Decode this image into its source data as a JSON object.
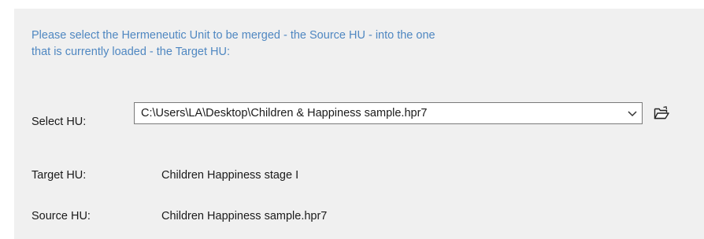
{
  "instructions": {
    "line1": "Please select the Hermeneutic Unit to be merged - the Source HU - into the one",
    "line2": "that is currently loaded - the Target HU:"
  },
  "select_hu": {
    "label": "Select HU:",
    "value": "C:\\Users\\LA\\Desktop\\Children & Happiness sample.hpr7"
  },
  "target_hu": {
    "label": "Target HU:",
    "value": "Children  Happiness stage I"
  },
  "source_hu": {
    "label": "Source HU:",
    "value": "Children  Happiness sample.hpr7"
  },
  "icons": {
    "dropdown": "chevron-down-icon",
    "open": "open-folder-icon"
  },
  "colors": {
    "instruction_text": "#4f87c1",
    "panel_background": "#f0f0f0"
  }
}
